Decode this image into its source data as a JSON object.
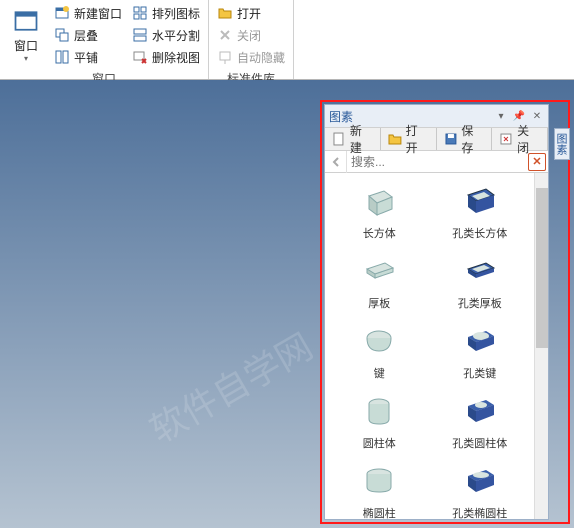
{
  "ribbon": {
    "group1_label": "窗口",
    "group2_label": "标准件库",
    "window_btn": "窗口",
    "new_window": "新建窗口",
    "cascade": "层叠",
    "tile": "平铺",
    "arrange_icons": "排列图标",
    "hsplit": "水平分割",
    "delete_view": "删除视图",
    "open": "打开",
    "close": "关闭",
    "auto_hide": "自动隐藏"
  },
  "panel": {
    "title": "图素",
    "new": "新建",
    "open": "打开",
    "save": "保存",
    "close": "关闭",
    "search_placeholder": "搜索..."
  },
  "items": [
    {
      "solid": "长方体",
      "hole": "孔类长方体"
    },
    {
      "solid": "厚板",
      "hole": "孔类厚板"
    },
    {
      "solid": "键",
      "hole": "孔类键"
    },
    {
      "solid": "圆柱体",
      "hole": "孔类圆柱体"
    },
    {
      "solid": "椭圆柱",
      "hole": "孔类椭圆柱"
    }
  ],
  "side_tab": "图素"
}
